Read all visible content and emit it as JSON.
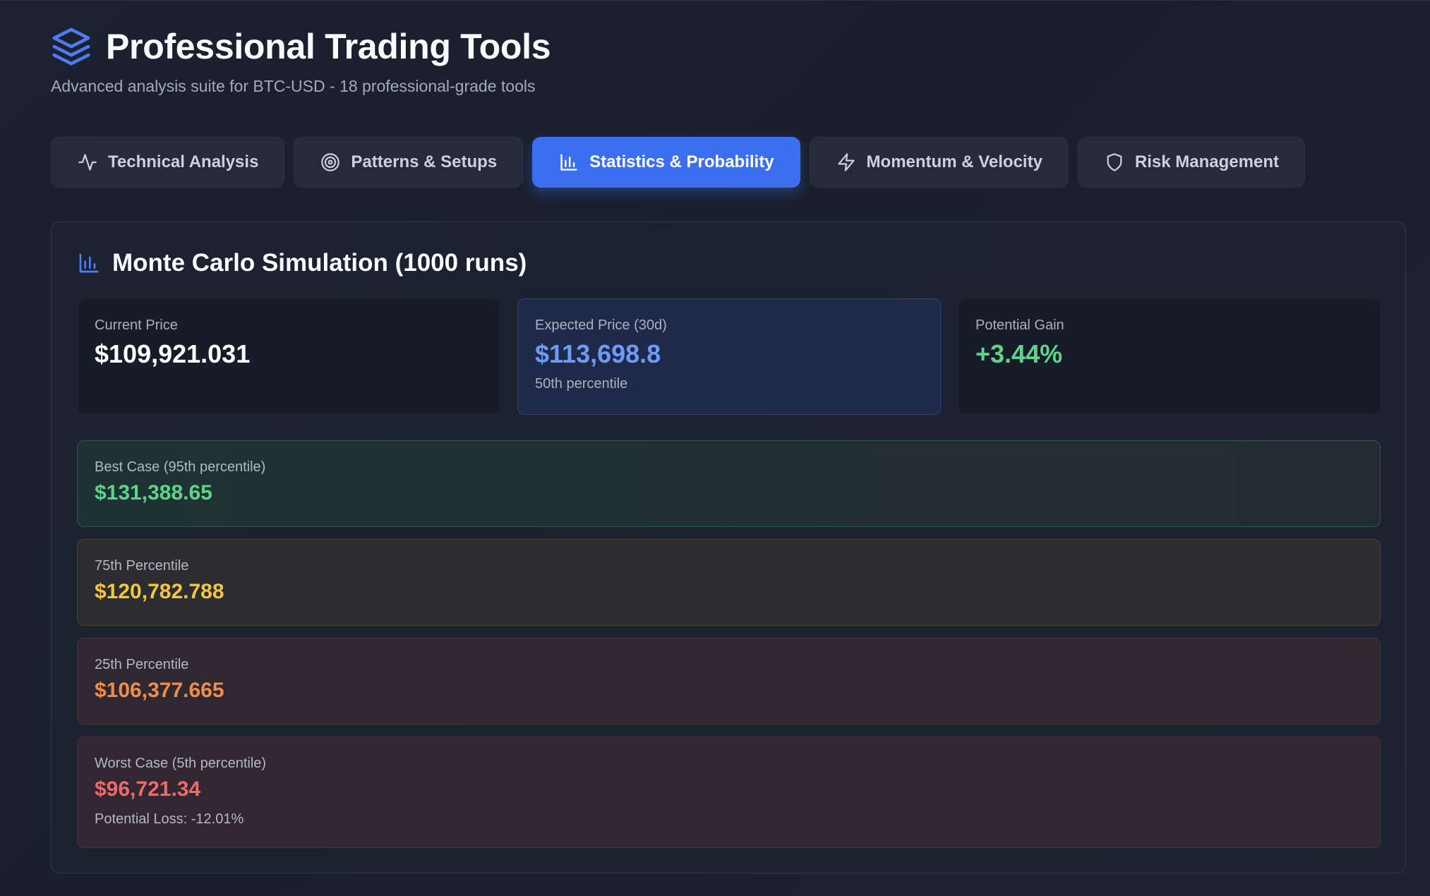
{
  "header": {
    "title": "Professional Trading Tools",
    "subtitle": "Advanced analysis suite for BTC-USD - 18 professional-grade tools",
    "logo_icon": "layers-icon"
  },
  "tabs": [
    {
      "label": "Technical Analysis",
      "icon": "activity-icon",
      "active": false
    },
    {
      "label": "Patterns & Setups",
      "icon": "target-icon",
      "active": false
    },
    {
      "label": "Statistics & Probability",
      "icon": "bar-chart-icon",
      "active": true
    },
    {
      "label": "Momentum & Velocity",
      "icon": "lightning-icon",
      "active": false
    },
    {
      "label": "Risk Management",
      "icon": "shield-icon",
      "active": false
    }
  ],
  "panel": {
    "title": "Monte Carlo Simulation (1000 runs)",
    "title_icon": "bar-chart-icon",
    "stats": {
      "current": {
        "label": "Current Price",
        "value": "$109,921.031"
      },
      "expected": {
        "label": "Expected Price (30d)",
        "value": "$113,698.8",
        "note": "50th percentile"
      },
      "gain": {
        "label": "Potential Gain",
        "value": "+3.44%"
      }
    },
    "scenarios": {
      "best": {
        "label": "Best Case (95th percentile)",
        "value": "$131,388.65"
      },
      "p75": {
        "label": "75th Percentile",
        "value": "$120,782.788"
      },
      "p25": {
        "label": "25th Percentile",
        "value": "$106,377.665"
      },
      "worst": {
        "label": "Worst Case (5th percentile)",
        "value": "$96,721.34",
        "note": "Potential Loss: -12.01%"
      }
    }
  },
  "colors": {
    "accent": "#3b6ff0",
    "expected_value": "#6e9bf5",
    "positive": "#5fd38a",
    "p75": "#f2c63f",
    "p25": "#f08d4a",
    "negative": "#ee6a6a"
  }
}
